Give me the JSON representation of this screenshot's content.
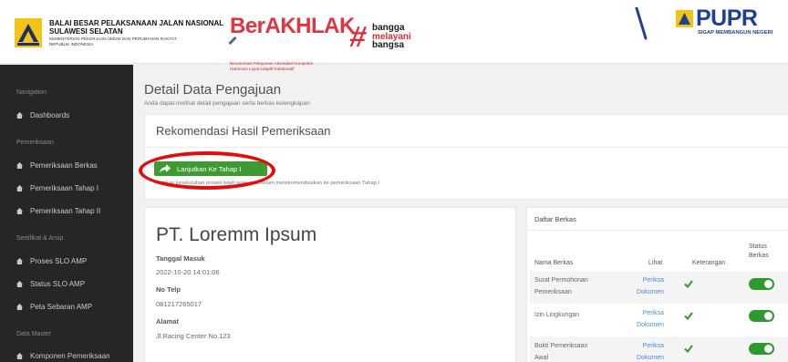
{
  "header": {
    "org_line1": "BALAI BESAR PELAKSANAAN JALAN NASIONAL",
    "org_line2": "SULAWESI SELATAN",
    "org_line3": "KEMENTERIAN PEKERJAAN UMUM DAN PERUMAHAN RAKYAT",
    "org_line4": "REPUBLIK INDONESIA",
    "berakhlak_title": "BerAKHLAK",
    "berakhlak_tag1": "Berorientasi Pelayanan Akuntabel Kompeten",
    "berakhlak_tag2": "Harmonis Loyal Adaptif Kolaboratif",
    "bangga_1": "bangga",
    "bangga_2": "melayani",
    "bangga_3": "bangsa",
    "pupr_title": "PUPR",
    "pupr_sub": "SIGAP MEMBANGUN NEGERI"
  },
  "sidebar": {
    "sections": [
      "Navigation",
      "Pemeriksaan",
      "Sertifikat & Arsip",
      "Data Master"
    ],
    "items": [
      {
        "label": "Dashboards"
      },
      {
        "label": "Pemeriksaan Berkas"
      },
      {
        "label": "Pemeriksaan Tahap I"
      },
      {
        "label": "Pemeriksaan Tahap II"
      },
      {
        "label": "Proses SLO AMP"
      },
      {
        "label": "Status SLO AMP"
      },
      {
        "label": "Peta Sebaran AMP"
      },
      {
        "label": "Komponen Pemeriksaan"
      }
    ]
  },
  "page": {
    "title": "Detail Data Pengajuan",
    "subtitle": "Anda dapat melihat detail pengajuan serta berkas kelengkapan"
  },
  "rekomendasi": {
    "title": "Rekomendasi Hasil Pemeriksaan",
    "button_label": "Lanjutkan Ke Tahap I",
    "note": "Pastikan keseluruhan proses telah selesai sebelum merekomendasikan ke pemeriksaan Tahap I"
  },
  "company": {
    "name": "PT. Loremm Ipsum",
    "tanggal_label": "Tanggal Masuk",
    "tanggal_value": "2022-10-20 14:01:06",
    "telp_label": "No Telp",
    "telp_value": "081217265017",
    "alamat_label": "Alamat",
    "alamat_value": "Jl.Racing Center No.123"
  },
  "berkas": {
    "title": "Daftar Berkas",
    "col_nama": "Nama Berkas",
    "col_lihat": "Lihat",
    "col_keterangan": "Keterangan",
    "col_status_1": "Status",
    "col_status_2": "Berkas",
    "rows": [
      {
        "name1": "Surat Permohonan",
        "name2": "Pemeriksaan",
        "link1": "Periksa",
        "link2": "Dokumen"
      },
      {
        "name1": "Izin Lingkungan",
        "name2": "",
        "link1": "Periksa",
        "link2": "Dokumen"
      },
      {
        "name1": "Bukti Pemeriksaan",
        "name2": "Awal",
        "link1": "Periksa",
        "link2": "Dokumen"
      }
    ]
  },
  "colors": {
    "sidebar_bg": "#262626",
    "button_green": "#3e9b31",
    "toggle_green": "#2e9a2e",
    "link_blue": "#4d8bd9",
    "highlight_red": "#e10d0d",
    "brand_red": "#e2333f",
    "pupr_blue": "#1f3f93"
  }
}
